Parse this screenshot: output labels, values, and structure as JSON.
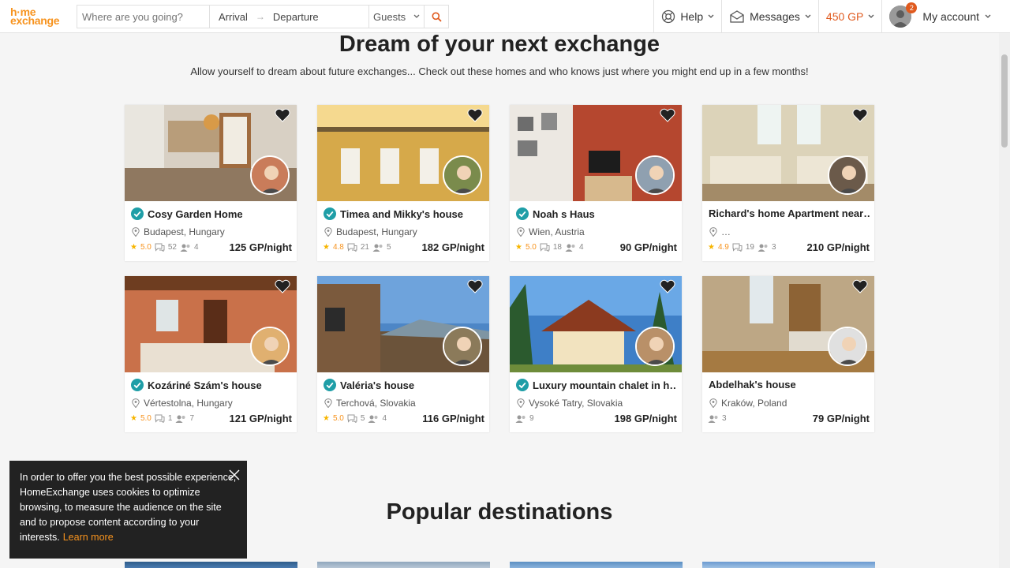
{
  "header": {
    "logo_line1": "h·me",
    "logo_line2": "exchange",
    "search": {
      "where_placeholder": "Where are you going?",
      "arrival": "Arrival",
      "arrow": "→",
      "departure": "Departure",
      "guests": "Guests"
    },
    "nav": {
      "help": "Help",
      "messages": "Messages",
      "gp": "450 GP",
      "account": "My account",
      "notification_count": "2"
    }
  },
  "main": {
    "title": "Dream of your next exchange",
    "subtitle": "Allow yourself to dream about future exchanges... Check out these homes and who knows just where you might end up in a few months!",
    "popular_title": "Popular destinations"
  },
  "listings": [
    {
      "title": "Cosy Garden Home",
      "location": "Budapest, Hungary",
      "verified": true,
      "rating": "5.0",
      "reviews": "52",
      "guests": "4",
      "price": "125 GP/night"
    },
    {
      "title": "Timea and Mikky's house",
      "location": "Budapest, Hungary",
      "verified": true,
      "rating": "4.8",
      "reviews": "21",
      "guests": "5",
      "price": "182 GP/night"
    },
    {
      "title": "Noah s Haus",
      "location": "Wien, Austria",
      "verified": true,
      "rating": "5.0",
      "reviews": "18",
      "guests": "4",
      "price": "90 GP/night"
    },
    {
      "title": "Richard's home Apartment near…",
      "location": "…",
      "verified": false,
      "rating": "4.9",
      "reviews": "19",
      "guests": "3",
      "price": "210 GP/night"
    },
    {
      "title": "Kozáriné Szám's house",
      "location": "Vértestolna, Hungary",
      "verified": true,
      "rating": "5.0",
      "reviews": "1",
      "guests": "7",
      "price": "121 GP/night"
    },
    {
      "title": "Valéria's house",
      "location": "Terchová, Slovakia",
      "verified": true,
      "rating": "5.0",
      "reviews": "5",
      "guests": "4",
      "price": "116 GP/night"
    },
    {
      "title": "Luxury mountain chalet in h…",
      "location": "Vysoké Tatry, Slovakia",
      "verified": true,
      "rating": "",
      "reviews": "",
      "guests": "9",
      "price": "198 GP/night"
    },
    {
      "title": "Abdelhak's house",
      "location": "Kraków, Poland",
      "verified": false,
      "rating": "",
      "reviews": "",
      "guests": "3",
      "price": "79 GP/night"
    }
  ],
  "cookie": {
    "text": "In order to offer you the best possible experience, HomeExchange uses cookies to optimize browsing, to measure the audience on the site and to propose content according to your interests.",
    "link": "Learn more"
  },
  "colors": {
    "accent": "#f7931e",
    "gp": "#e05a1e",
    "verified": "#1f9ea7"
  }
}
